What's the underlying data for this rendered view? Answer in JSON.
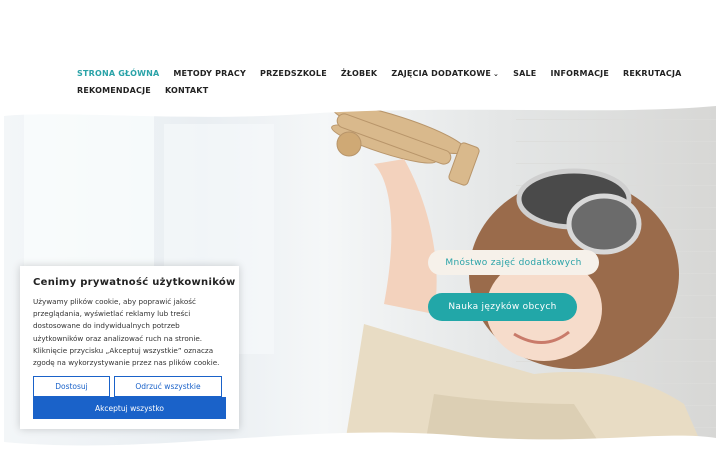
{
  "nav": {
    "row1": [
      "STRONA GŁÓWNA",
      "METODY PRACY",
      "PRZEDSZKOLE",
      "ŻŁOBEK",
      "ZAJĘCIA DODATKOWE",
      "SALE",
      "INFORMACJE",
      "REKRUTACJA"
    ],
    "row2": [
      "REKOMENDACJE",
      "KONTAKT"
    ],
    "active": "STRONA GŁÓWNA",
    "dropdown_icon": "chevron-down-icon"
  },
  "hero": {
    "pill_light": "Mnóstwo zajęć dodatkowych",
    "pill_teal": "Nauka języków obcych",
    "colors": {
      "teal": "#22a7a8",
      "pill_light_bg": "#f6f1ea"
    }
  },
  "cookie": {
    "title": "Cenimy prywatność użytkowników",
    "body": "Używamy plików cookie, aby poprawić jakość przeglądania, wyświetlać reklamy lub treści dostosowane do indywidualnych potrzeb użytkowników oraz analizować ruch na stronie. Kliknięcie przycisku „Akceptuj wszystkie” oznacza zgodę na wykorzystywanie przez nas plików cookie.",
    "customize": "Dostosuj",
    "reject": "Odrzuć wszystkie",
    "accept": "Akceptuj wszystko",
    "colors": {
      "button_blue": "#1a62c9"
    }
  }
}
